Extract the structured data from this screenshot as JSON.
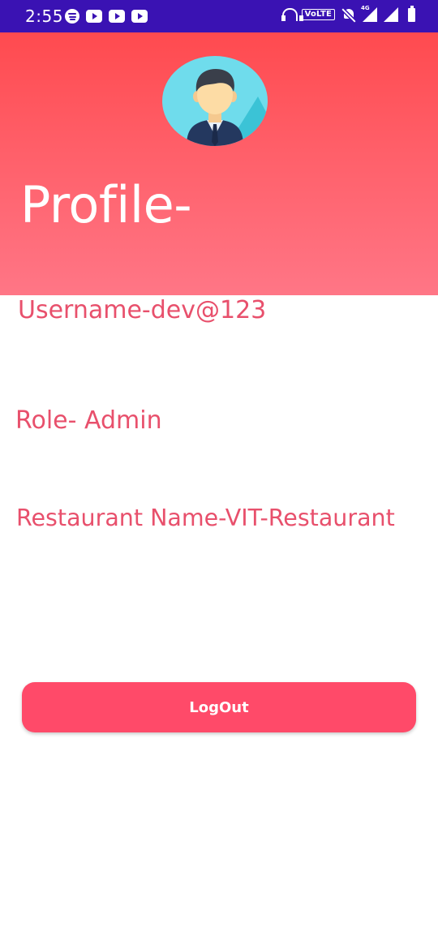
{
  "status_bar": {
    "time": "2:55",
    "app_icons": [
      "spotify-icon",
      "youtube-icon",
      "youtube-icon",
      "youtube-icon"
    ],
    "volte_label": "VoLTE",
    "network_label": "4G",
    "background_color": "#3a12b3"
  },
  "profile": {
    "title": "Profile-",
    "avatar_icon": "user-avatar-icon",
    "username_text": "Username-dev@123",
    "role_text": "Role- Admin",
    "restaurant_text": "Restaurant Name-VIT-Restaurant"
  },
  "actions": {
    "logout_label": "LogOut"
  },
  "colors": {
    "header_gradient_top": "#ff4a4f",
    "header_gradient_bottom": "#ff7686",
    "info_text": "#e8506c",
    "button": "#ff4a69"
  }
}
